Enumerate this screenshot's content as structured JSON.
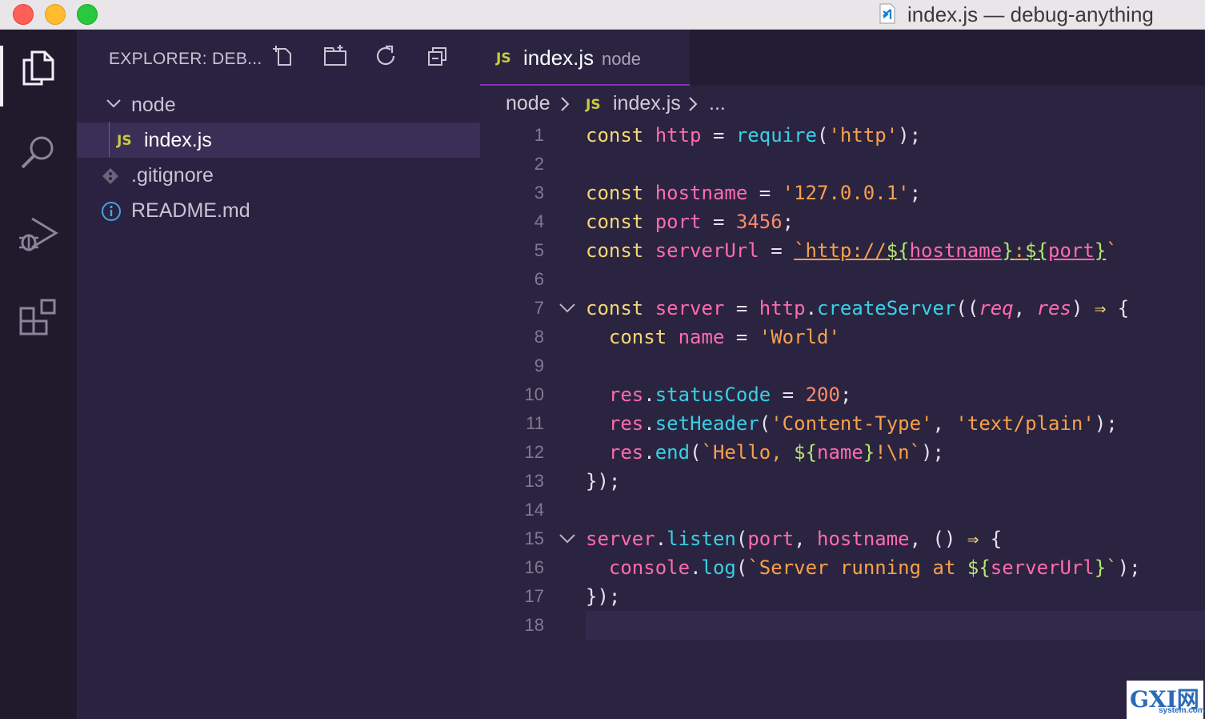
{
  "window": {
    "title": "index.js — debug-anything"
  },
  "activity_bar": {
    "items": [
      "explorer-icon",
      "search-icon",
      "debug-icon",
      "extensions-icon"
    ],
    "active": "explorer-icon"
  },
  "sidebar": {
    "title": "EXPLORER: DEB...",
    "toolbar": [
      "new-file-icon",
      "new-folder-icon",
      "refresh-icon",
      "collapse-all-icon"
    ],
    "tree": {
      "folder": "node",
      "folder_files": [
        {
          "badge": "JS",
          "name": "index.js"
        }
      ],
      "root_files": [
        {
          "icon": "git-icon",
          "name": ".gitignore"
        },
        {
          "icon": "info-icon",
          "name": "README.md"
        }
      ]
    }
  },
  "editor": {
    "tab": {
      "badge": "JS",
      "name": "index.js",
      "desc": "node"
    },
    "breadcrumb": {
      "folder": "node",
      "badge": "JS",
      "file": "index.js",
      "rest": "..."
    },
    "line_numbers": [
      "1",
      "2",
      "3",
      "4",
      "5",
      "6",
      "7",
      "8",
      "9",
      "10",
      "11",
      "12",
      "13",
      "14",
      "15",
      "16",
      "17",
      "18"
    ],
    "code": {
      "l1": [
        "const",
        " ",
        "http",
        " = ",
        "require",
        "(",
        "'http'",
        ");"
      ],
      "l3": [
        "const",
        " ",
        "hostname",
        " = ",
        "'127.0.0.1'",
        ";"
      ],
      "l4": [
        "const",
        " ",
        "port",
        " = ",
        "3456",
        ";"
      ],
      "l5": [
        "const",
        " ",
        "serverUrl",
        " = ",
        "`http://",
        "${",
        "hostname",
        "}",
        ":",
        "${",
        "port",
        "}",
        "`"
      ],
      "l7": [
        "const",
        " ",
        "server",
        " = ",
        "http",
        ".",
        "createServer",
        "((",
        "req",
        ", ",
        "res",
        ") ",
        "⇒",
        " {"
      ],
      "l8": [
        "  ",
        "const",
        " ",
        "name",
        " = ",
        "'World'"
      ],
      "l10": [
        "  ",
        "res",
        ".",
        "statusCode",
        " = ",
        "200",
        ";"
      ],
      "l11": [
        "  ",
        "res",
        ".",
        "setHeader",
        "(",
        "'Content-Type'",
        ", ",
        "'text/plain'",
        ");"
      ],
      "l12": [
        "  ",
        "res",
        ".",
        "end",
        "(",
        "`Hello, ",
        "${",
        "name",
        "}",
        "!\\n`",
        ");"
      ],
      "l13": [
        "});"
      ],
      "l15": [
        "server",
        ".",
        "listen",
        "(",
        "port",
        ", ",
        "hostname",
        ", () ",
        "⇒",
        " {"
      ],
      "l16": [
        "  ",
        "console",
        ".",
        "log",
        "(",
        "`Server running at ",
        "${",
        "serverUrl",
        "}",
        "`",
        ");"
      ],
      "l17": [
        "});"
      ]
    },
    "colors": {
      "keyword": "#f7d774",
      "variable": "#ff6bb0",
      "function": "#39d0e6",
      "string": "#f9a04c",
      "number": "#ff8a6a",
      "interpolation": "#b7e56d",
      "selection_accent": "#8a2fb8"
    }
  },
  "watermark": {
    "text": "GXI网",
    "sub": "system.com"
  }
}
